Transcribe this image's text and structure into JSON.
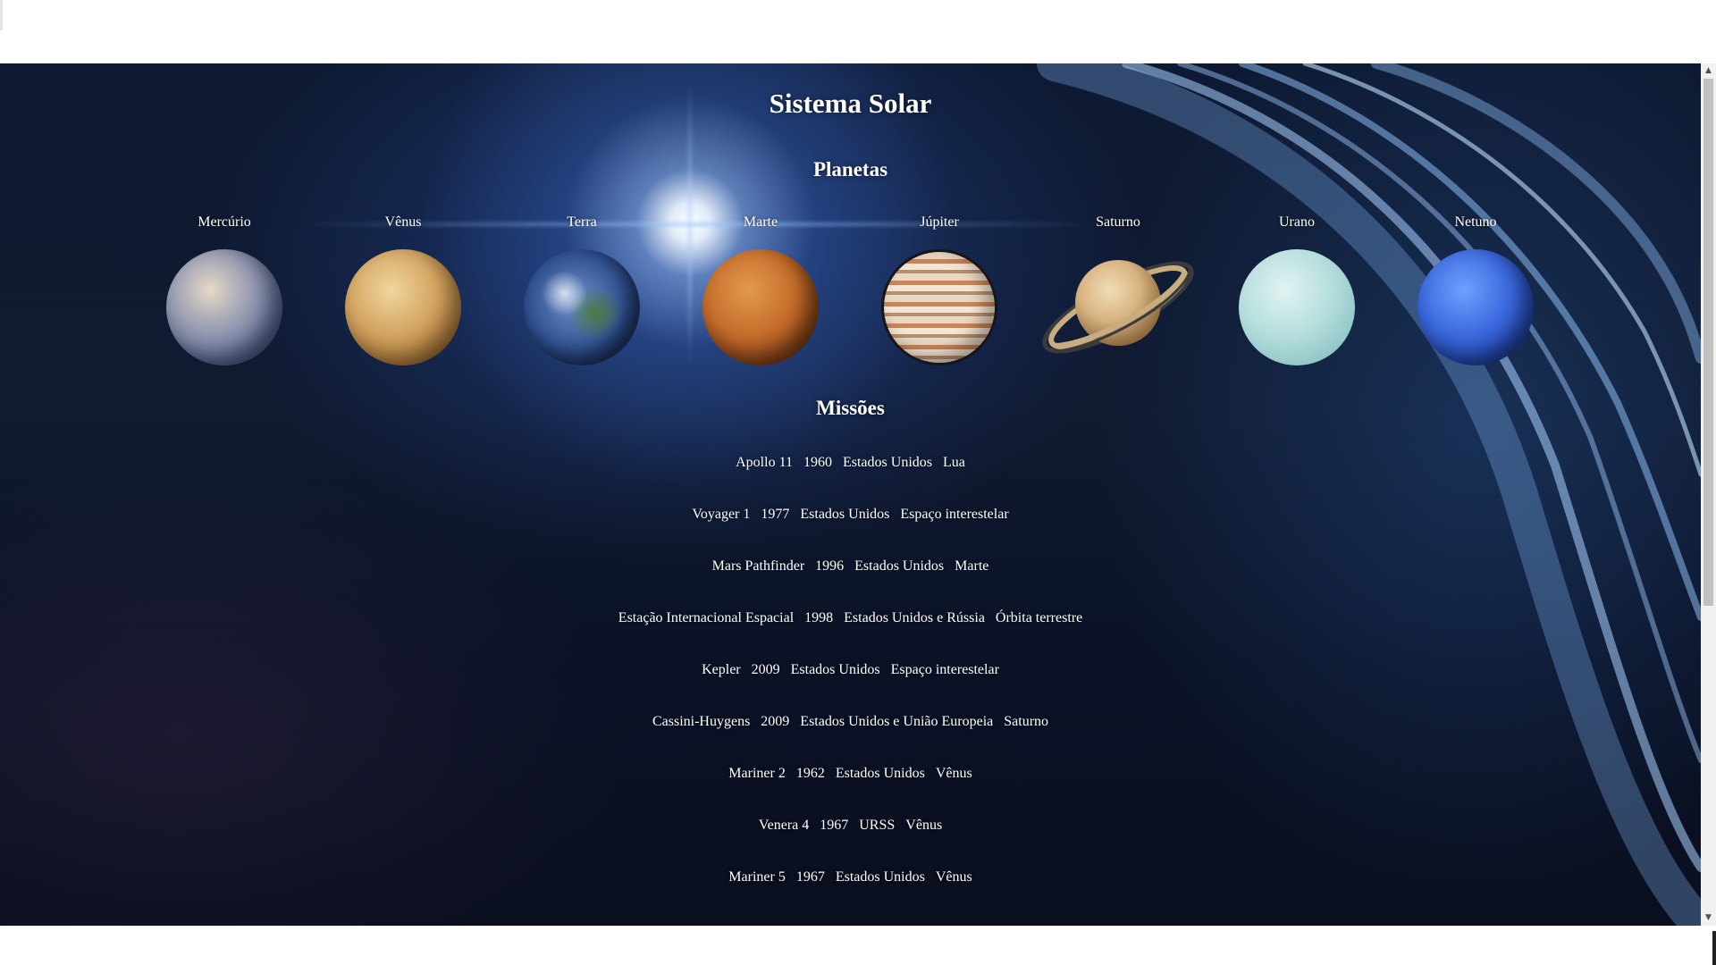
{
  "page": {
    "title": "Sistema Solar",
    "planets_heading": "Planetas",
    "missions_heading": "Missões"
  },
  "planets": [
    {
      "name": "Mercúrio",
      "icon": "mercury-image"
    },
    {
      "name": "Vênus",
      "icon": "venus-image"
    },
    {
      "name": "Terra",
      "icon": "earth-image"
    },
    {
      "name": "Marte",
      "icon": "mars-image"
    },
    {
      "name": "Júpiter",
      "icon": "jupiter-image"
    },
    {
      "name": "Saturno",
      "icon": "saturn-image"
    },
    {
      "name": "Urano",
      "icon": "uranus-image"
    },
    {
      "name": "Netuno",
      "icon": "neptune-image"
    }
  ],
  "missions": [
    {
      "name": "Apollo 11",
      "year": "1960",
      "country": "Estados Unidos",
      "target": "Lua"
    },
    {
      "name": "Voyager 1",
      "year": "1977",
      "country": "Estados Unidos",
      "target": "Espaço interestelar"
    },
    {
      "name": "Mars Pathfinder",
      "year": "1996",
      "country": "Estados Unidos",
      "target": "Marte"
    },
    {
      "name": "Estação Internacional Espacial",
      "year": "1998",
      "country": "Estados Unidos e Rússia",
      "target": "Órbita terrestre"
    },
    {
      "name": "Kepler",
      "year": "2009",
      "country": "Estados Unidos",
      "target": "Espaço interestelar"
    },
    {
      "name": "Cassini-Huygens",
      "year": "2009",
      "country": "Estados Unidos e União Europeia",
      "target": "Saturno"
    },
    {
      "name": "Mariner 2",
      "year": "1962",
      "country": "Estados Unidos",
      "target": "Vênus"
    },
    {
      "name": "Venera 4",
      "year": "1967",
      "country": "URSS",
      "target": "Vênus"
    },
    {
      "name": "Mariner 5",
      "year": "1967",
      "country": "Estados Unidos",
      "target": "Vênus"
    }
  ],
  "scrollbar": {
    "up_icon": "scroll-up-arrow-icon",
    "down_icon": "scroll-down-arrow-icon"
  }
}
